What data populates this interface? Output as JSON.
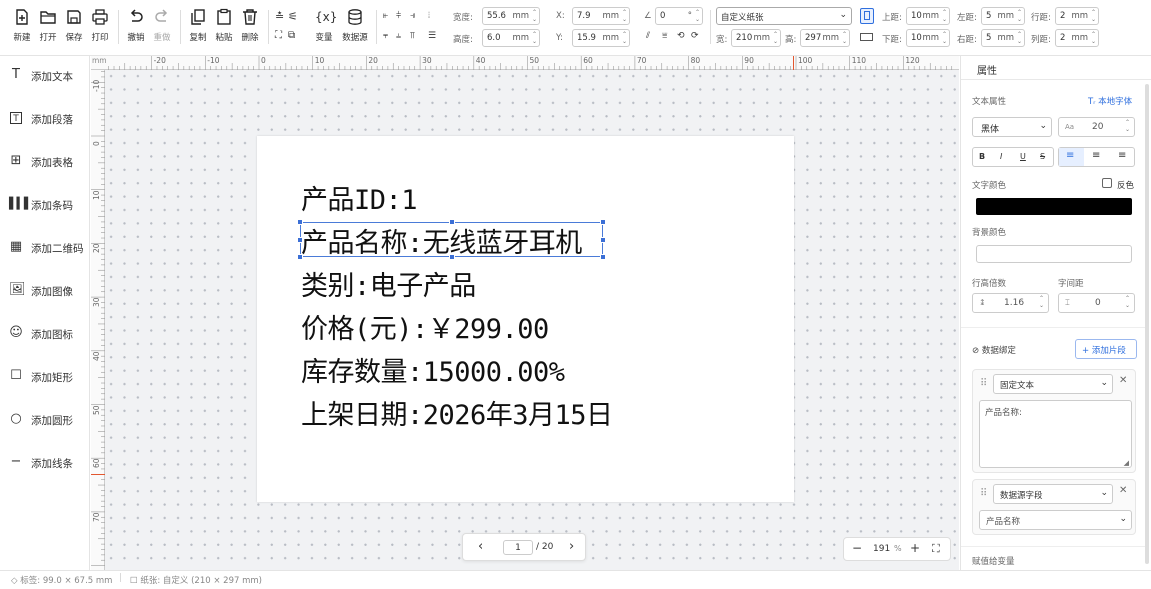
{
  "toolbar": {
    "new": "新建",
    "open": "打开",
    "save": "保存",
    "print": "打印",
    "undo": "撤销",
    "redo": "重做",
    "copy": "复制",
    "paste": "粘贴",
    "delete": "删除",
    "variable": "变量",
    "datasource": "数据源",
    "width_label": "宽度:",
    "width_value": "55.6",
    "height_label": "高度:",
    "height_value": "6.0",
    "unit": "mm",
    "x_label": "X:",
    "x_value": "7.9",
    "y_label": "Y:",
    "y_value": "15.9",
    "rotate_value": "0",
    "rotate_unit": "°",
    "paper_select": "自定义纸张",
    "paper_w_label": "宽:",
    "paper_w": "210",
    "paper_h_label": "高:",
    "paper_h": "297",
    "margin_top_label": "上距:",
    "margin_top": "10",
    "margin_bottom_label": "下距:",
    "margin_bottom": "10",
    "margin_left_label": "左距:",
    "margin_left": "5",
    "margin_right_label": "右距:",
    "margin_right": "5",
    "row_gap_label": "行距:",
    "row_gap": "2",
    "col_gap_label": "列距:",
    "col_gap": "2"
  },
  "left_panel": [
    {
      "icon": "text-icon",
      "label": "添加文本"
    },
    {
      "icon": "paragraph-icon",
      "label": "添加段落"
    },
    {
      "icon": "table-icon",
      "label": "添加表格"
    },
    {
      "icon": "barcode-icon",
      "label": "添加条码"
    },
    {
      "icon": "qrcode-icon",
      "label": "添加二维码"
    },
    {
      "icon": "image-icon",
      "label": "添加图像"
    },
    {
      "icon": "smiley-icon",
      "label": "添加图标"
    },
    {
      "icon": "rectangle-icon",
      "label": "添加矩形"
    },
    {
      "icon": "circle-icon",
      "label": "添加圆形"
    },
    {
      "icon": "line-icon",
      "label": "添加线条"
    }
  ],
  "ruler": {
    "unit": "mm",
    "h_marks": [
      "-20",
      "-10",
      "0",
      "10",
      "20",
      "30",
      "40",
      "50",
      "60",
      "70",
      "80",
      "90",
      "100",
      "110",
      "120"
    ],
    "v_marks": [
      "-10",
      "0",
      "10",
      "20",
      "30",
      "40",
      "50",
      "60",
      "70"
    ]
  },
  "page_lines": [
    "产品ID:1",
    "产品名称:无线蓝牙耳机",
    "类别:电子产品",
    "价格(元):￥299.00",
    "库存数量:15000.00%",
    "上架日期:2026年3月15日"
  ],
  "pager": {
    "prev": "‹",
    "current": "1",
    "total": "/ 20",
    "next": "›"
  },
  "zoom": {
    "minus": "−",
    "value": "191",
    "unit": "%",
    "plus": "+"
  },
  "right_panel": {
    "title": "属性",
    "text_props": "文本属性",
    "local_font": "本地字体",
    "font": "黑体",
    "font_size": "20",
    "font_size_icon": "Aa",
    "bold": "B",
    "italic": "I",
    "underline": "U",
    "strike": "S",
    "text_color": "文字颜色",
    "invert": "反色",
    "text_color_value": "#000000",
    "bg_color": "背景颜色",
    "line_height": "行高倍数",
    "line_height_value": "1.16",
    "letter_spacing": "字间距",
    "letter_spacing_value": "0",
    "data_binding": "数据绑定",
    "add_segment": "+ 添加片段",
    "seg1_type": "固定文本",
    "seg1_value": "产品名称:",
    "seg2_type": "数据源字段",
    "seg2_value": "产品名称",
    "assign_var": "赋值给变量"
  },
  "status": {
    "label": "标签: 99.0 × 67.5 mm",
    "paper": "纸张: 自定义 (210 × 297 mm)"
  },
  "colors": {
    "accent": "#2f6fde",
    "selection": "#4a7bd8",
    "canvas_bg": "#f1f2f4"
  }
}
